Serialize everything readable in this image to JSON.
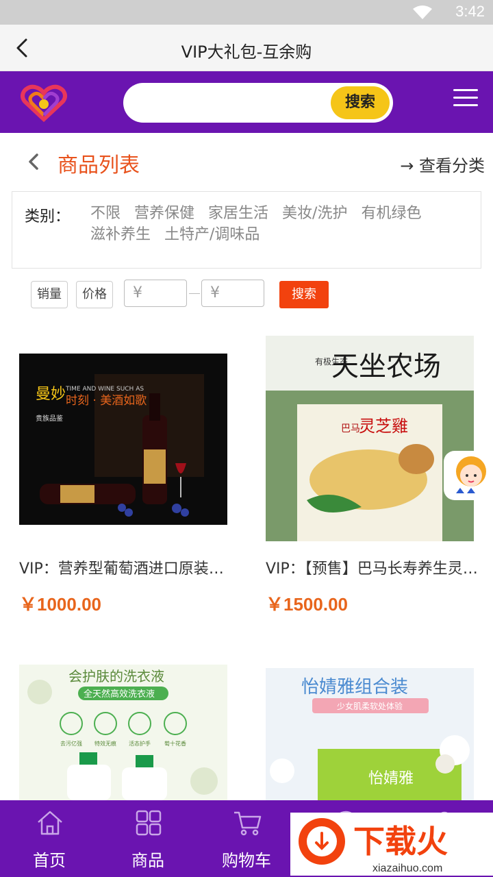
{
  "status_bar": {
    "time": "3:42"
  },
  "title_bar": {
    "title": "VIP大礼包-互余购"
  },
  "header": {
    "search_placeholder": "",
    "search_button": "搜索"
  },
  "section": {
    "heading": "商品列表",
    "view_category": "→ 查看分类"
  },
  "categories": {
    "label": "类别：",
    "options": [
      "不限",
      "营养保健",
      "家居生活",
      "美妆/洗护",
      "有机绿色",
      "滋补养生",
      "土特产/调味品"
    ]
  },
  "filters": {
    "sales": "销量",
    "price": "价格",
    "min_price_placeholder": "¥",
    "max_price_placeholder": "¥",
    "search": "搜索"
  },
  "products": [
    {
      "title": "VIP：营养型葡萄酒进口原装法国红酒",
      "price": "￥1000.00",
      "image_text": {
        "line1": "曼妙",
        "line2": "时刻 · 美酒如歌",
        "line3": "TIME AND WINE SUCH AS",
        "line4": "贵族品鉴"
      }
    },
    {
      "title": "VIP：【预售】巴马长寿养生灵芝鸡",
      "price": "￥1500.00",
      "image_text": {
        "line1": "有极生态",
        "line2": "天坐农场",
        "line3": "巴马",
        "line4": "灵芝雞"
      }
    },
    {
      "title": "",
      "price": "",
      "image_text": {
        "line1": "会护肤的洗衣液",
        "line2": "全天然高效洗衣液",
        "icons": [
          "去污亿强",
          "特效无痕",
          "活态护手",
          "萄十花香"
        ]
      }
    },
    {
      "title": "",
      "price": "",
      "image_text": {
        "line1": "怡婧雅组合装",
        "line2": "少女肌柔软处体验",
        "brand": "怡婧雅"
      }
    }
  ],
  "bottom_nav": [
    {
      "label": "首页",
      "icon": "home-icon"
    },
    {
      "label": "商品",
      "icon": "grid-icon"
    },
    {
      "label": "购物车",
      "icon": "cart-icon"
    },
    {
      "label": "",
      "icon": "vip-icon"
    },
    {
      "label": "",
      "icon": "user-icon"
    }
  ],
  "watermark": {
    "brand": "下载火",
    "url": "xiazaihuo.com"
  },
  "colors": {
    "purple": "#6a14b0",
    "orange": "#e8651c",
    "yellow": "#f5c518",
    "red_btn": "#f2420e"
  }
}
